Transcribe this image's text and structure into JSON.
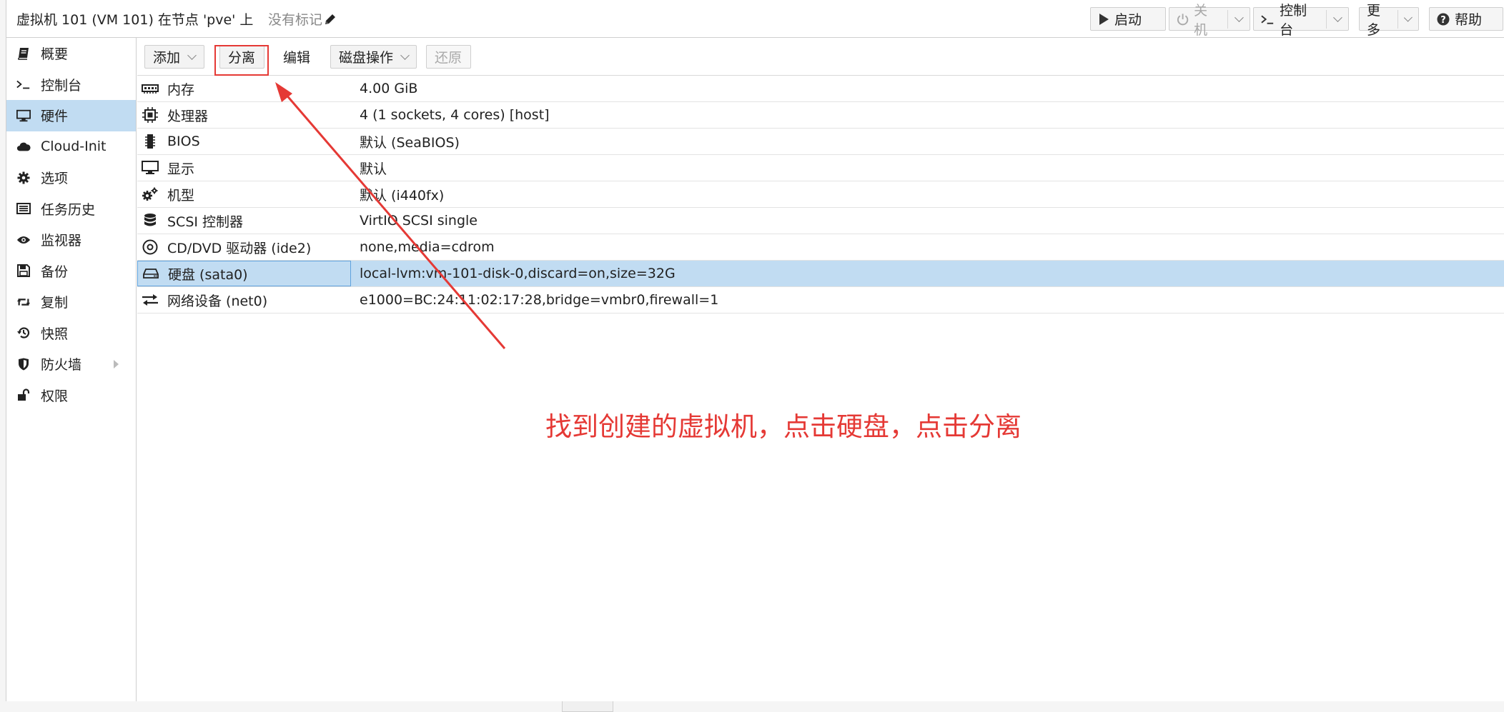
{
  "header": {
    "title": "虚拟机 101 (VM 101) 在节点 'pve' 上",
    "tags": "没有标记",
    "buttons": {
      "start": "启动",
      "shutdown": "关机",
      "console": "控制台",
      "more": "更多",
      "help": "帮助"
    }
  },
  "sidebar": {
    "items": [
      {
        "label": "概要",
        "icon": "book-icon"
      },
      {
        "label": "控制台",
        "icon": "terminal-icon"
      },
      {
        "label": "硬件",
        "icon": "monitor-icon"
      },
      {
        "label": "Cloud-Init",
        "icon": "cloud-icon"
      },
      {
        "label": "选项",
        "icon": "gear-icon"
      },
      {
        "label": "任务历史",
        "icon": "list-icon"
      },
      {
        "label": "监视器",
        "icon": "eye-icon"
      },
      {
        "label": "备份",
        "icon": "floppy-icon"
      },
      {
        "label": "复制",
        "icon": "retweet-icon"
      },
      {
        "label": "快照",
        "icon": "history-icon"
      },
      {
        "label": "防火墙",
        "icon": "shield-icon"
      },
      {
        "label": "权限",
        "icon": "unlock-icon"
      }
    ],
    "active": "硬件"
  },
  "toolbar": {
    "add": "添加",
    "detach": "分离",
    "edit": "编辑",
    "disk_action": "磁盘操作",
    "revert": "还原"
  },
  "hardware": {
    "rows": [
      {
        "name": "内存",
        "value": "4.00 GiB",
        "icon": "memory-icon"
      },
      {
        "name": "处理器",
        "value": "4 (1 sockets, 4 cores) [host]",
        "icon": "cpu-icon"
      },
      {
        "name": "BIOS",
        "value": "默认 (SeaBIOS)",
        "icon": "chip-icon"
      },
      {
        "name": "显示",
        "value": "默认",
        "icon": "display-icon"
      },
      {
        "name": "机型",
        "value": "默认 (i440fx)",
        "icon": "cogs-icon"
      },
      {
        "name": "SCSI 控制器",
        "value": "VirtIO SCSI single",
        "icon": "database-icon"
      },
      {
        "name": "CD/DVD 驱动器 (ide2)",
        "value": "none,media=cdrom",
        "icon": "disc-icon"
      },
      {
        "name": "硬盘 (sata0)",
        "value": "local-lvm:vm-101-disk-0,discard=on,size=32G",
        "icon": "hdd-icon"
      },
      {
        "name": "网络设备 (net0)",
        "value": "e1000=BC:24:11:02:17:28,bridge=vmbr0,firewall=1",
        "icon": "exchange-icon"
      }
    ],
    "selected": "硬盘 (sata0)"
  },
  "annotation": "找到创建的虚拟机，点击硬盘，点击分离",
  "colors": {
    "selection": "#c1dcf2",
    "annotation": "#e53935"
  }
}
